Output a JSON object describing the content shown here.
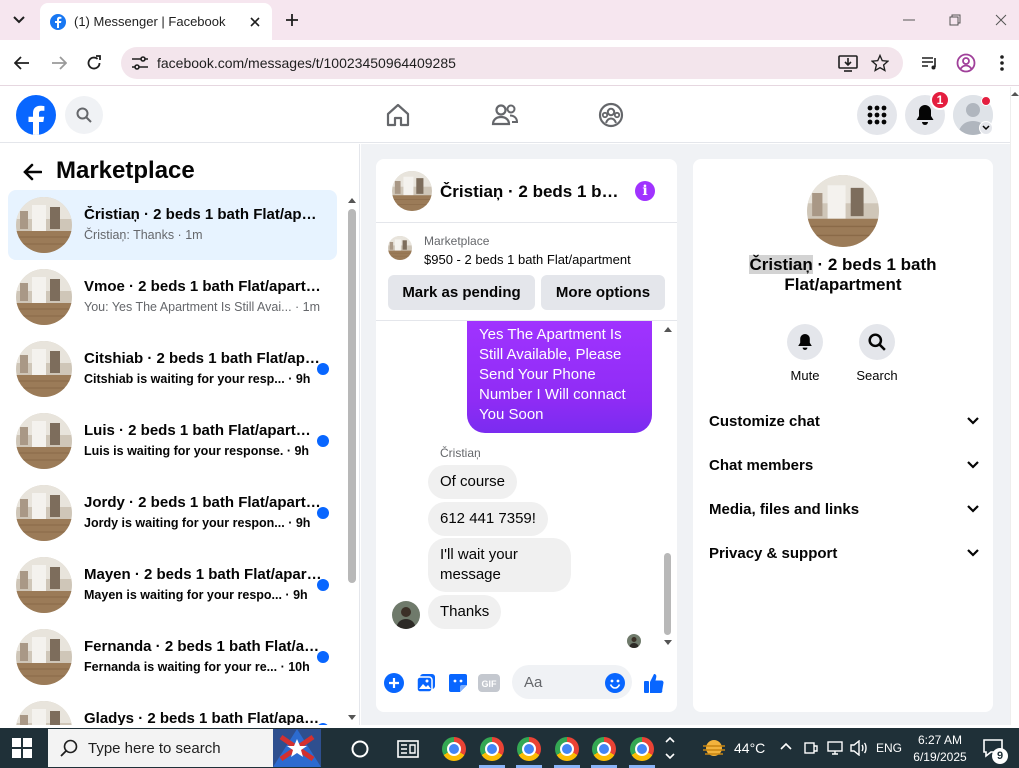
{
  "browser": {
    "tab_title": "(1) Messenger | Facebook",
    "url": "facebook.com/messages/t/10023450964409285"
  },
  "header": {
    "notification_count": "1"
  },
  "left": {
    "title": "Marketplace",
    "conversations": [
      {
        "name": "Čristiaņ · 2 beds 1 bath Flat/apartment",
        "preview": "Čristiaņ: Thanks · 1m",
        "unread": false,
        "active": true
      },
      {
        "name": "Vmoe · 2 beds 1 bath Flat/apartment",
        "preview": "You: Yes The Apartment Is Still Avai... · 1m",
        "unread": false,
        "active": false
      },
      {
        "name": "Citshiab · 2 beds 1 bath Flat/apartment",
        "preview": "Citshiab is waiting for your resp... · 9h",
        "unread": true,
        "active": false
      },
      {
        "name": "Luis · 2 beds 1 bath Flat/apartment",
        "preview": "Luis is waiting for your response. · 9h",
        "unread": true,
        "active": false
      },
      {
        "name": "Jordy · 2 beds 1 bath Flat/apartment",
        "preview": "Jordy is waiting for your respon... · 9h",
        "unread": true,
        "active": false
      },
      {
        "name": "Mayen · 2 beds 1 bath Flat/apartment",
        "preview": "Mayen is waiting for your respo... · 9h",
        "unread": true,
        "active": false
      },
      {
        "name": "Fernanda · 2 beds 1 bath Flat/apartment",
        "preview": "Fernanda is waiting for your re... · 10h",
        "unread": true,
        "active": false
      },
      {
        "name": "Gladys · 2 beds 1 bath Flat/apartment",
        "preview": "",
        "unread": true,
        "active": false
      }
    ]
  },
  "chat": {
    "title": "Čristiaņ · 2 beds 1 bath Flat/apartment",
    "marketplace_label": "Marketplace",
    "listing": "$950 - 2 beds 1 bath Flat/apartment",
    "mark_pending": "Mark as pending",
    "more_options": "More options",
    "outgoing_message": "Yes The Apartment Is Still Available, Please Send Your Phone Number I Will connact You Soon",
    "sender_name": "Čristiaņ",
    "incoming": [
      "Of course",
      "612 441 7359!",
      "I'll wait your message",
      "Thanks"
    ],
    "composer_placeholder": "Aa"
  },
  "info": {
    "name_highlight": "Čristiaņ",
    "name_rest": " · 2 beds 1 bath Flat/apartment",
    "mute_label": "Mute",
    "search_label": "Search",
    "sections": [
      "Customize chat",
      "Chat members",
      "Media, files and links",
      "Privacy & support"
    ]
  },
  "taskbar": {
    "search_placeholder": "Type here to search",
    "temperature": "44°C",
    "language": "ENG",
    "time": "6:27 AM",
    "date": "6/19/2025",
    "notification_count": "9"
  },
  "colors": {
    "facebook_blue": "#0866ff",
    "messenger_purple": "#a033ff",
    "unread_dot": "#0866ff",
    "badge_red": "#e41e3f"
  },
  "icons": {
    "browser": [
      "tab-search-icon",
      "close-icon",
      "plus-icon",
      "minimize-icon",
      "restore-icon",
      "back-icon",
      "forward-icon",
      "reload-icon",
      "tune-icon",
      "install-icon",
      "star-icon",
      "media-icon",
      "profile-icon",
      "kebab-icon"
    ],
    "facebook": [
      "facebook-logo-icon",
      "search-icon",
      "home-icon",
      "friends-icon",
      "groups-icon",
      "menu-grid-icon",
      "bell-icon",
      "info-icon",
      "bell-icon",
      "search-icon",
      "chevron-down-icon"
    ],
    "composer": [
      "plus-circle-icon",
      "gallery-icon",
      "sticker-icon",
      "gif-icon",
      "emoji-icon",
      "thumbs-up-icon"
    ]
  }
}
